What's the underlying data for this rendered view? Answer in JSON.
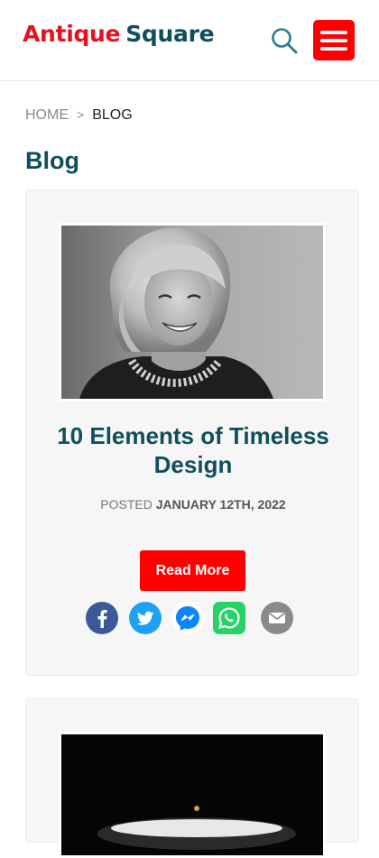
{
  "header": {
    "logo_word_1": "Antique",
    "logo_word_2": "Square",
    "search_icon": "search-icon",
    "menu_icon": "hamburger-menu-icon"
  },
  "breadcrumb": {
    "home": "HOME",
    "separator": ">",
    "current": "BLOG"
  },
  "page_title": "Blog",
  "posts": [
    {
      "title": "10 Elements of Timeless Design",
      "posted_label": "POSTED",
      "date": "JANUARY 12TH, 2022",
      "read_more_label": "Read More",
      "share_icons": [
        "facebook-icon",
        "twitter-icon",
        "messenger-icon",
        "whatsapp-icon",
        "email-icon"
      ]
    }
  ],
  "colors": {
    "brand_red": "#e8101c",
    "brand_teal": "#0f4f5c",
    "button_red": "#ff0000",
    "facebook": "#3b5998",
    "twitter": "#1da1f2",
    "messenger": "#0a84ff",
    "whatsapp": "#25d366",
    "email": "#8a8a8a"
  }
}
